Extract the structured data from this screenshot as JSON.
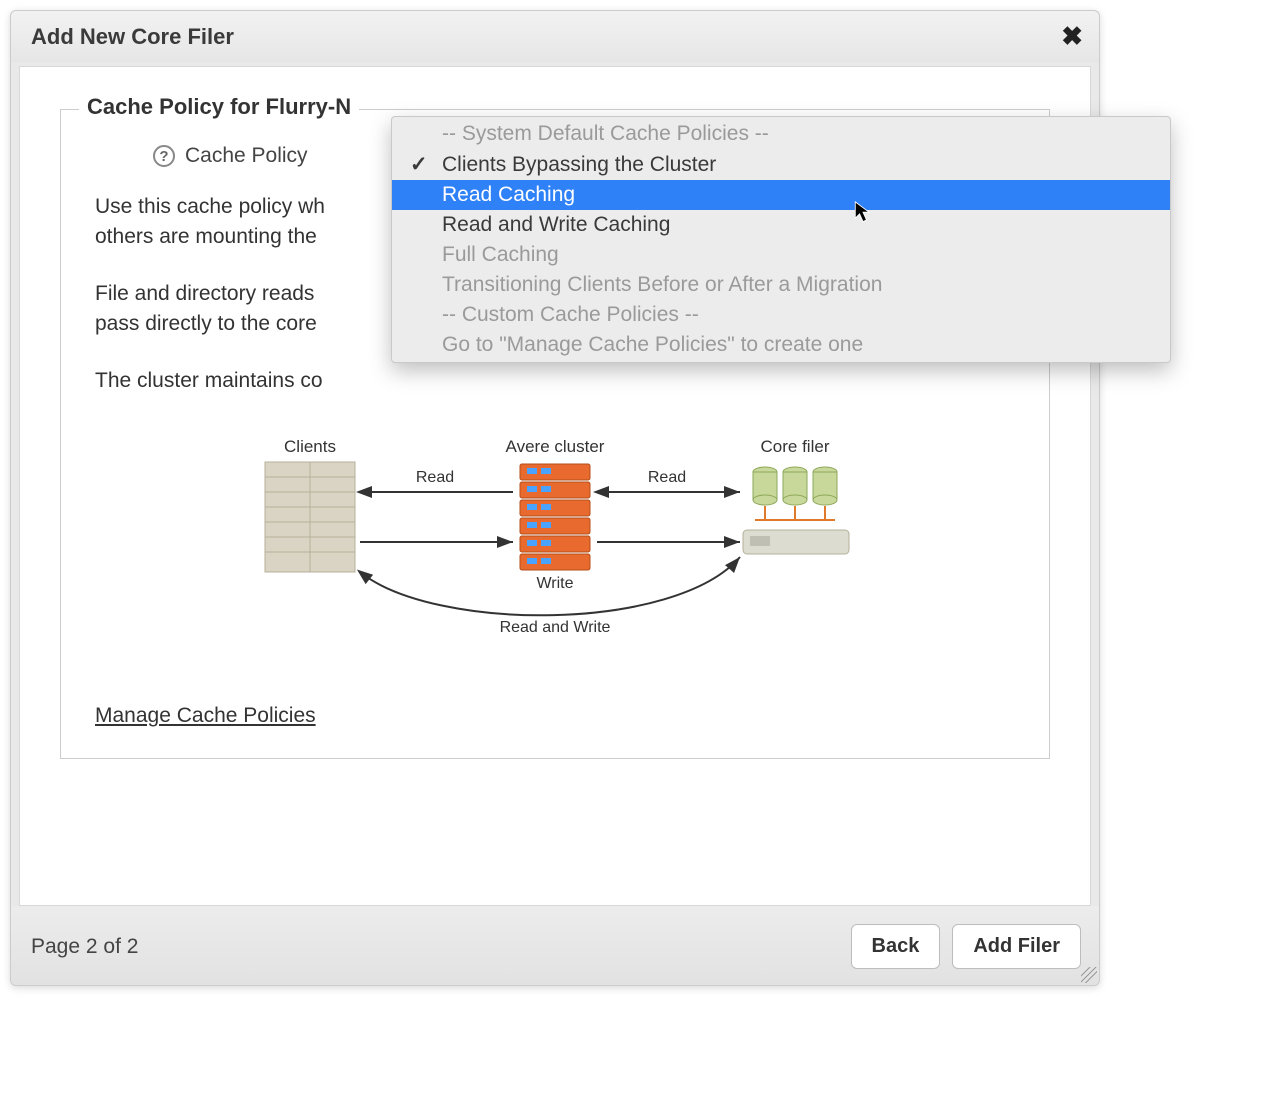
{
  "dialog": {
    "title": "Add New Core Filer"
  },
  "fieldset": {
    "legend_prefix": "Cache Policy for ",
    "filer_name_visible": "Flurry-N",
    "policy_label": "Cache Policy"
  },
  "description": {
    "p1_visible": "Use this cache policy wh",
    "p1_line2_visible": "others are mounting the",
    "p2_visible": "File and directory reads",
    "p2_line2_visible": "pass directly to the core",
    "p3_visible": "The cluster maintains co"
  },
  "diagram": {
    "clients_label": "Clients",
    "cluster_label": "Avere cluster",
    "corefiler_label": "Core filer",
    "read_label": "Read",
    "write_label": "Write",
    "readwrite_label": "Read and Write"
  },
  "manage_link": "Manage Cache Policies",
  "footer": {
    "page_indicator": "Page 2 of 2",
    "back": "Back",
    "add_filer": "Add Filer"
  },
  "dropdown": {
    "header_system": "-- System Default Cache Policies --",
    "opt_bypass": "Clients Bypassing the Cluster",
    "opt_readcaching": "Read Caching",
    "opt_readwrite": "Read and Write Caching",
    "opt_full": "Full Caching",
    "opt_transition": "Transitioning Clients Before or After a Migration",
    "header_custom": "-- Custom Cache Policies --",
    "opt_goto_manage": "Go to \"Manage Cache Policies\" to create one",
    "checked_value": "Clients Bypassing the Cluster",
    "highlighted_value": "Read Caching"
  }
}
